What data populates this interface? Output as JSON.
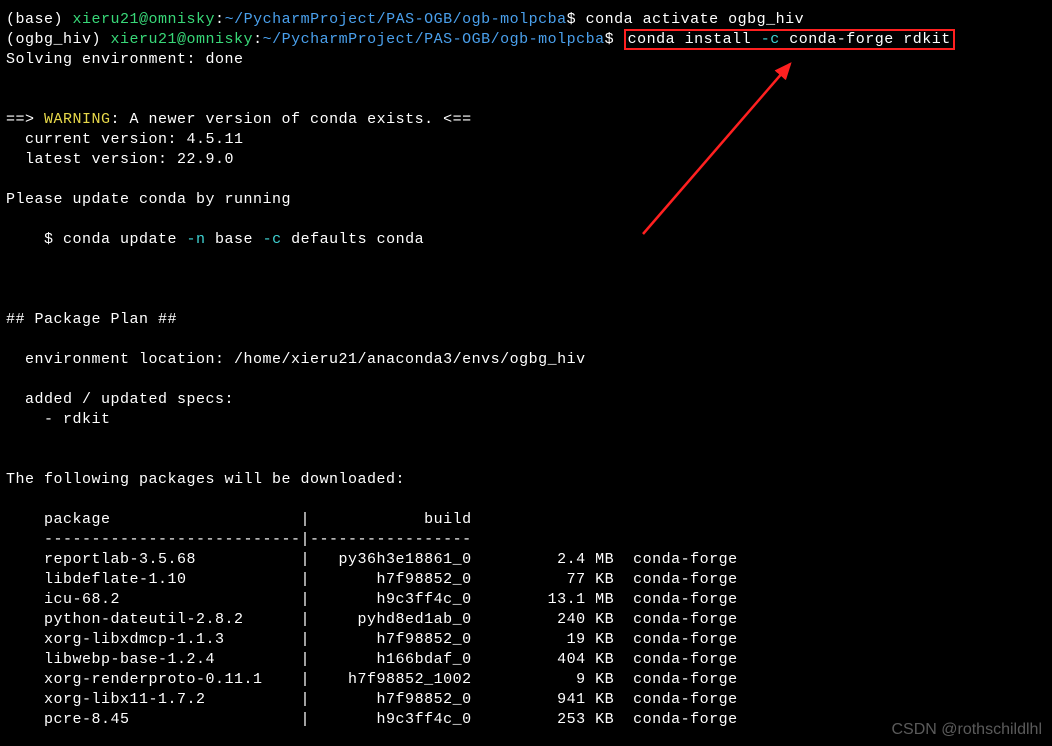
{
  "line1": {
    "env": "(base) ",
    "userhost": "xieru21@omnisky",
    "colon": ":",
    "path": "~/PycharmProject/PAS-OGB/ogb-molpcba",
    "prompt": "$ ",
    "cmd": "conda activate ogbg_hiv"
  },
  "line2": {
    "env": "(ogbg_hiv) ",
    "userhost": "xieru21@omnisky",
    "colon": ":",
    "path": "~/PycharmProject/PAS-OGB/ogb-molpcba",
    "prompt": "$ ",
    "cmd_pre": "conda install ",
    "cmd_flag": "-c",
    "cmd_post": " conda-forge rdkit"
  },
  "solving": "Solving environment: done",
  "warn_arrow_l": "==> ",
  "warn_label": "WARNING",
  "warn_text": ": A newer version of conda exists. <==",
  "warn_cur": "  current version: 4.5.11",
  "warn_lat": "  latest version: 22.9.0",
  "please_update": "Please update conda by running",
  "update_line_pre": "    $ conda update ",
  "update_flag1": "-n",
  "update_mid1": " base ",
  "update_flag2": "-c",
  "update_mid2": " defaults conda",
  "pkg_plan": "## Package Plan ##",
  "env_loc": "  environment location: /home/xieru21/anaconda3/envs/ogbg_hiv",
  "added_specs": "  added / updated specs: ",
  "spec_item": "    - rdkit",
  "following": "The following packages will be downloaded:",
  "tbl_header": "    package                    |            build",
  "tbl_sep": "    ---------------------------|-----------------",
  "packages": [
    {
      "name": "    reportlab-3.5.68           |",
      "build": "   py36h3e18861_0",
      "size": "         2.4 MB",
      "chan": "  conda-forge"
    },
    {
      "name": "    libdeflate-1.10            |",
      "build": "       h7f98852_0",
      "size": "          77 KB",
      "chan": "  conda-forge"
    },
    {
      "name": "    icu-68.2                   |",
      "build": "       h9c3ff4c_0",
      "size": "        13.1 MB",
      "chan": "  conda-forge"
    },
    {
      "name": "    python-dateutil-2.8.2      |",
      "build": "     pyhd8ed1ab_0",
      "size": "         240 KB",
      "chan": "  conda-forge"
    },
    {
      "name": "    xorg-libxdmcp-1.1.3        |",
      "build": "       h7f98852_0",
      "size": "          19 KB",
      "chan": "  conda-forge"
    },
    {
      "name": "    libwebp-base-1.2.4         |",
      "build": "       h166bdaf_0",
      "size": "         404 KB",
      "chan": "  conda-forge"
    },
    {
      "name": "    xorg-renderproto-0.11.1    |",
      "build": "    h7f98852_1002",
      "size": "           9 KB",
      "chan": "  conda-forge"
    },
    {
      "name": "    xorg-libx11-1.7.2          |",
      "build": "       h7f98852_0",
      "size": "         941 KB",
      "chan": "  conda-forge"
    },
    {
      "name": "    pcre-8.45                  |",
      "build": "       h9c3ff4c_0",
      "size": "         253 KB",
      "chan": "  conda-forge"
    }
  ],
  "watermark": "CSDN @rothschildlhl"
}
